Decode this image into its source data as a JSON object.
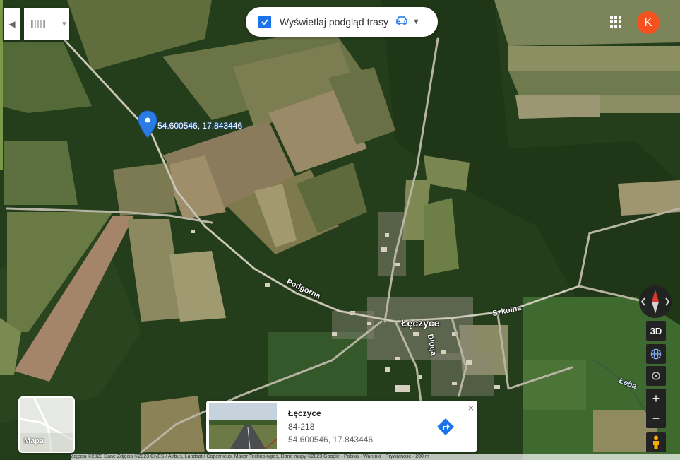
{
  "top_bar": {
    "preview_checkbox_label": "Wyświetlaj podgląd trasy",
    "preview_checked": true,
    "avatar_letter": "K",
    "avatar_color": "#f4511e"
  },
  "pin": {
    "coords_label": "54.600546, 17.843446"
  },
  "map_labels": {
    "road_podgorna": "Podgórna",
    "town": "Łęczyce",
    "road_szkolna": "Szkolna",
    "road_dluga": "Długa",
    "river_leba": "Łeba"
  },
  "controls": {
    "btn_3d": "3D",
    "minimap_label": "Mapa",
    "zoom_in": "+",
    "zoom_out": "−"
  },
  "place_card": {
    "title": "Łęczyce",
    "postal": "84-218",
    "coordinates": "54.600546, 17.843446",
    "close": "×"
  },
  "footer": {
    "attribution": "Zdjęcia ©2023 Dane Zdjęcia ©2023 CNES / Airbus, Landsat / Copernicus, Maxar Technologies, Dane mapy ©2023 Google · Polska · Warunki · Prywatność · 200 m"
  },
  "icons": {
    "collapse": "chevron-left-icon",
    "keyboard": "keyboard-icon",
    "car": "car-icon",
    "apps": "apps-grid-icon",
    "compass": "compass-icon",
    "globe": "globe-icon",
    "location": "my-location-icon",
    "pegman": "pegman-icon",
    "directions": "directions-icon"
  },
  "colors": {
    "accent": "#1a73e8",
    "map_control_bg": "#222222"
  }
}
